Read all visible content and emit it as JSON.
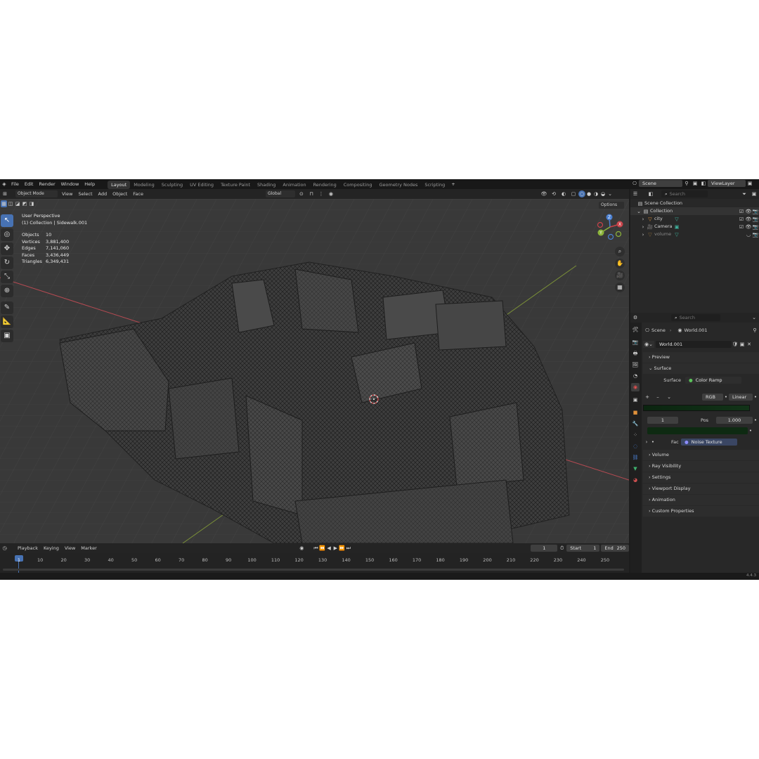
{
  "menu": [
    "File",
    "Edit",
    "Render",
    "Window",
    "Help"
  ],
  "workspaces": [
    "Layout",
    "Modeling",
    "Sculpting",
    "UV Editing",
    "Texture Paint",
    "Shading",
    "Animation",
    "Rendering",
    "Compositing",
    "Geometry Nodes",
    "Scripting"
  ],
  "active_workspace": "Layout",
  "add_workspace": "+",
  "scene_name": "Scene",
  "view_layer": "ViewLayer",
  "viewport_header": {
    "mode": "Object Mode",
    "menus": [
      "View",
      "Select",
      "Add",
      "Object",
      "Face"
    ],
    "transform": "Global",
    "options": "Options"
  },
  "viewport_info": {
    "perspective": "User Perspective",
    "collection": "(1) Collection | Sidewalk.001",
    "stats": [
      {
        "label": "Objects",
        "value": "10"
      },
      {
        "label": "Vertices",
        "value": "3,881,400"
      },
      {
        "label": "Edges",
        "value": "7,141,060"
      },
      {
        "label": "Faces",
        "value": "3,436,449"
      },
      {
        "label": "Triangles",
        "value": "6,349,431"
      }
    ]
  },
  "gizmo": {
    "x": "X",
    "y": "Y",
    "z": "Z"
  },
  "timeline": {
    "menus": [
      "Playback",
      "Keying",
      "View",
      "Marker"
    ],
    "current_frame": "1",
    "start_label": "Start",
    "start": "1",
    "end_label": "End",
    "end": "250",
    "ticks": [
      "1",
      "10",
      "20",
      "30",
      "40",
      "50",
      "60",
      "70",
      "80",
      "90",
      "100",
      "110",
      "120",
      "130",
      "140",
      "150",
      "160",
      "170",
      "180",
      "190",
      "200",
      "210",
      "220",
      "230",
      "240",
      "250"
    ]
  },
  "outliner": {
    "search_placeholder": "Search",
    "root": "Scene Collection",
    "collection": "Collection",
    "items": [
      "city",
      "Camera",
      "volume"
    ]
  },
  "properties": {
    "search_placeholder": "Search",
    "breadcrumb_scene": "Scene",
    "breadcrumb_world": "World.001",
    "world_name": "World.001",
    "panels": {
      "preview": "Preview",
      "surface": "Surface",
      "volume": "Volume",
      "ray_visibility": "Ray Visibility",
      "settings": "Settings",
      "viewport_display": "Viewport Display",
      "animation": "Animation",
      "custom_properties": "Custom Properties"
    },
    "surface_label": "Surface",
    "surface_value": "Color Ramp",
    "ramp_plus": "+",
    "ramp_minus": "–",
    "ramp_color_mode": "RGB",
    "ramp_interp": "Linear",
    "ramp_index": "1",
    "pos_label": "Pos",
    "pos_value": "1.000",
    "fac_label": "Fac",
    "fac_value": "Noise Texture"
  },
  "version": "4.4.3",
  "colors": {
    "accent": "#4772b3",
    "x_axis": "#c9434a",
    "y_axis": "#8bb33a",
    "z_axis": "#4a7fd1",
    "ramp_dark_green": "#0e2a12"
  }
}
